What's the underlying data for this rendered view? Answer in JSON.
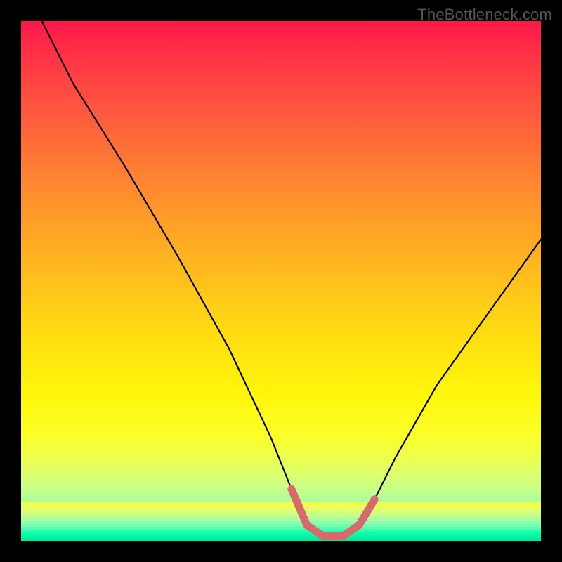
{
  "watermark": "TheBottleneck.com",
  "chart_data": {
    "type": "line",
    "title": "",
    "xlabel": "",
    "ylabel": "",
    "xlim": [
      0,
      100
    ],
    "ylim": [
      0,
      100
    ],
    "series": [
      {
        "name": "curve",
        "x": [
          4,
          10,
          20,
          30,
          40,
          48,
          52,
          55,
          58,
          62,
          65,
          68,
          72,
          80,
          90,
          100
        ],
        "values": [
          100,
          88,
          72,
          55,
          37,
          20,
          10,
          3,
          1,
          1,
          3,
          8,
          16,
          30,
          44,
          58
        ]
      }
    ],
    "highlight": {
      "name": "trough",
      "x": [
        52,
        55,
        58,
        62,
        65,
        68
      ],
      "values": [
        10,
        3,
        1,
        1,
        3,
        8
      ]
    },
    "gradient_stops": [
      {
        "pos": 0.0,
        "color": "#ff174b"
      },
      {
        "pos": 0.06,
        "color": "#ff3046"
      },
      {
        "pos": 0.18,
        "color": "#ff5a3e"
      },
      {
        "pos": 0.32,
        "color": "#ff8a2f"
      },
      {
        "pos": 0.46,
        "color": "#ffb520"
      },
      {
        "pos": 0.6,
        "color": "#ffdc12"
      },
      {
        "pos": 0.72,
        "color": "#fff70a"
      },
      {
        "pos": 0.8,
        "color": "#fbff2a"
      },
      {
        "pos": 0.85,
        "color": "#e9ff59"
      },
      {
        "pos": 0.9,
        "color": "#c8ff88"
      },
      {
        "pos": 0.95,
        "color": "#88ffb6"
      },
      {
        "pos": 1.0,
        "color": "#22ffb0"
      }
    ]
  }
}
